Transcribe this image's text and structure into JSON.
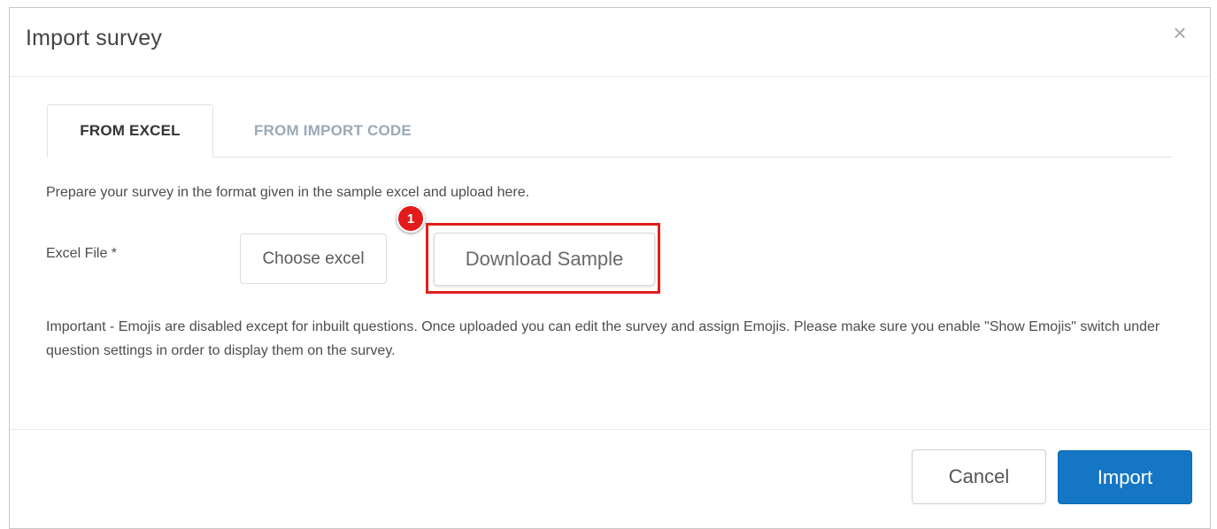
{
  "dialog": {
    "title": "Import survey",
    "close_glyph": "×"
  },
  "tabs": [
    {
      "label": "FROM EXCEL",
      "active": true
    },
    {
      "label": "FROM IMPORT CODE",
      "active": false
    }
  ],
  "content": {
    "instruction": "Prepare your survey in the format given in the sample excel and upload here.",
    "excel_field_label": "Excel File *",
    "choose_button_label": "Choose excel",
    "download_button_label": "Download Sample",
    "step_badge": "1",
    "important_note": "Important - Emojis are disabled except for inbuilt questions. Once uploaded you can edit the survey and assign Emojis. Please make sure you enable \"Show Emojis\" switch under question settings in order to display them on the survey."
  },
  "footer": {
    "cancel_label": "Cancel",
    "import_label": "Import"
  },
  "colors": {
    "primary": "#1476c4",
    "highlight": "#e02020",
    "inactive_tab": "#9aa9b8"
  },
  "icons": {
    "close": "close-icon"
  }
}
